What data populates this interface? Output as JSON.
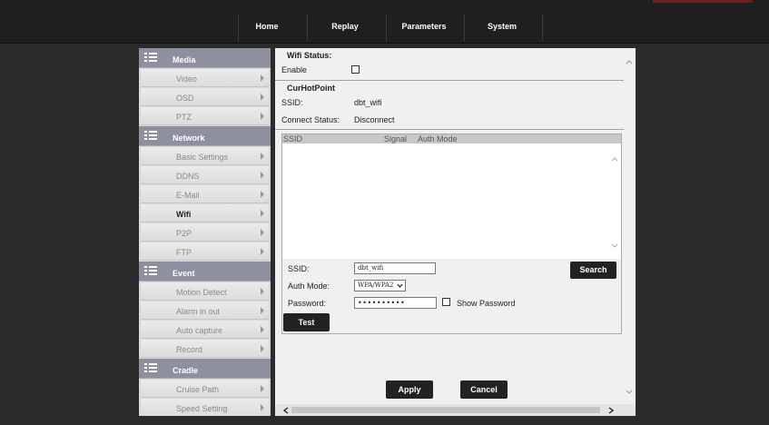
{
  "nav": {
    "items": [
      "Home",
      "Replay",
      "Parameters",
      "System"
    ]
  },
  "sidebar": {
    "sections": [
      {
        "label": "Media",
        "items": [
          "Video",
          "OSD",
          "PTZ"
        ]
      },
      {
        "label": "Network",
        "items": [
          "Basic Settings",
          "DDNS",
          "E-Mail",
          "Wifi",
          "P2P",
          "FTP"
        ]
      },
      {
        "label": "Event",
        "items": [
          "Motion Detect",
          "Alarm in out",
          "Auto capture",
          "Record"
        ]
      },
      {
        "label": "Cradle",
        "items": [
          "Cruise Path",
          "Speed Setting"
        ]
      }
    ],
    "active_item": "Wifi"
  },
  "wifi_status": {
    "heading": "Wifi Status:",
    "enable_label": "Enable",
    "enable_checked": false
  },
  "cur_hotpoint": {
    "heading": "CurHotPoint",
    "ssid_label": "SSID:",
    "ssid_value": "dbt_wifi",
    "connect_label": "Connect Status:",
    "connect_value": "Disconnect"
  },
  "scan_list": {
    "columns": [
      "SSID",
      "Signal",
      "Auth Mode"
    ],
    "rows": []
  },
  "form": {
    "ssid_label": "SSID:",
    "ssid_value": "dbt_wifi",
    "auth_label": "Auth Mode:",
    "auth_value": "WPA/WPA2",
    "password_label": "Password:",
    "password_value": "••••••••••",
    "show_password_label": "Show Password",
    "show_password_checked": false,
    "search_button": "Search",
    "test_button": "Test"
  },
  "actions": {
    "apply": "Apply",
    "cancel": "Cancel"
  },
  "colors": {
    "topbar": "#1f1f1f",
    "section_header": "#8e90a0",
    "button": "#222222",
    "panel": "#f0f0f0"
  }
}
